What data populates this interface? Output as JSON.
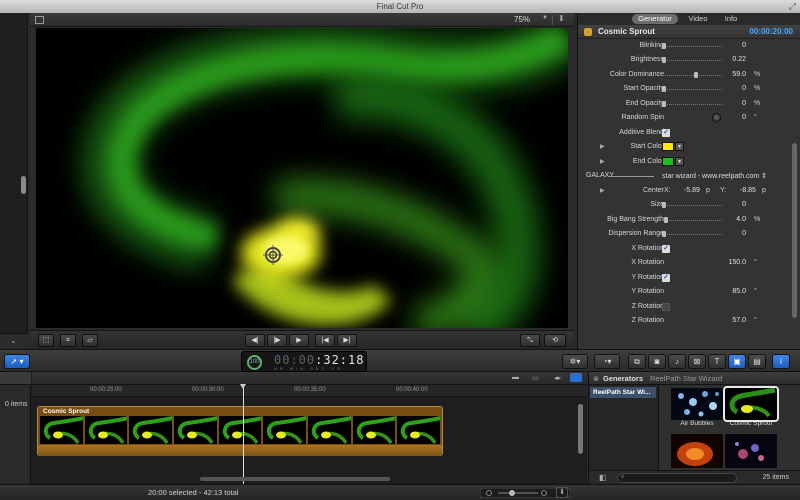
{
  "app": {
    "title": "Final Cut Pro"
  },
  "viewer": {
    "zoom": "75%"
  },
  "inspector": {
    "tabs": [
      "Generator",
      "Video",
      "Info"
    ],
    "generator_name": "Cosmic Sprout",
    "duration": "00:00:20:00",
    "params": [
      {
        "label": "Blinking",
        "value": "0",
        "unit": ""
      },
      {
        "label": "Brightness",
        "value": "0.22",
        "unit": ""
      },
      {
        "label": "Color Dominance",
        "value": "59.0",
        "unit": "%"
      },
      {
        "label": "Start Opacity",
        "value": "0",
        "unit": "%"
      },
      {
        "label": "End Opacity",
        "value": "0",
        "unit": "%"
      },
      {
        "label": "Random Spin",
        "value": "0",
        "unit": "°"
      },
      {
        "label": "Additive Blend",
        "checked": true
      },
      {
        "label": "Start Color",
        "color": "#ffe800"
      },
      {
        "label": "End Color",
        "color": "#19c21c"
      },
      {
        "label": "GALAXY",
        "popup": "star wizard - www.reelpath.com"
      },
      {
        "label": "Center",
        "x_label": "X:",
        "x": "-5.89",
        "x_unit": "p",
        "y_label": "Y:",
        "y": "-8.85",
        "y_unit": "p"
      },
      {
        "label": "Size",
        "value": "0",
        "unit": ""
      },
      {
        "label": "Big Bang  Strength",
        "value": "4.0",
        "unit": "%"
      },
      {
        "label": "Dispersion Range",
        "value": "0",
        "unit": ""
      },
      {
        "label": "X Rotation",
        "checked": true
      },
      {
        "label": "X Rotation",
        "value": "150.0",
        "unit": "°"
      },
      {
        "label": "Y Rotation",
        "checked": true
      },
      {
        "label": "Y Rotation",
        "value": "85.0",
        "unit": "°"
      },
      {
        "label": "Z Rotation",
        "checked": false
      },
      {
        "label": "Z Rotation",
        "value": "57.0",
        "unit": "°"
      }
    ]
  },
  "toolbar": {
    "timecode_dim": "00:00",
    "timecode_main": "32:18",
    "timecode_units": "HR MIN SEC FR",
    "render_pct": "100"
  },
  "timeline": {
    "index_count": "0 items",
    "ruler": [
      "00:00:25:00",
      "00:00:30:00",
      "00:00:35:00",
      "00:00:40:00"
    ],
    "clip_name": "Cosmic Sprout"
  },
  "browser": {
    "title": "Generators",
    "subtitle": "ReelPath Star Wizard",
    "list_item": "ReelPath Star Wi...",
    "tiles": [
      "Air Bubbles",
      "Cosmic Sprout"
    ],
    "count": "25 items"
  },
  "status": {
    "selection": "20:00 selected - 42:13 total"
  },
  "colors": {
    "accent": "#1d5cc0",
    "timecode_blue": "#4aa8ff",
    "clip": "#7a4d13"
  }
}
